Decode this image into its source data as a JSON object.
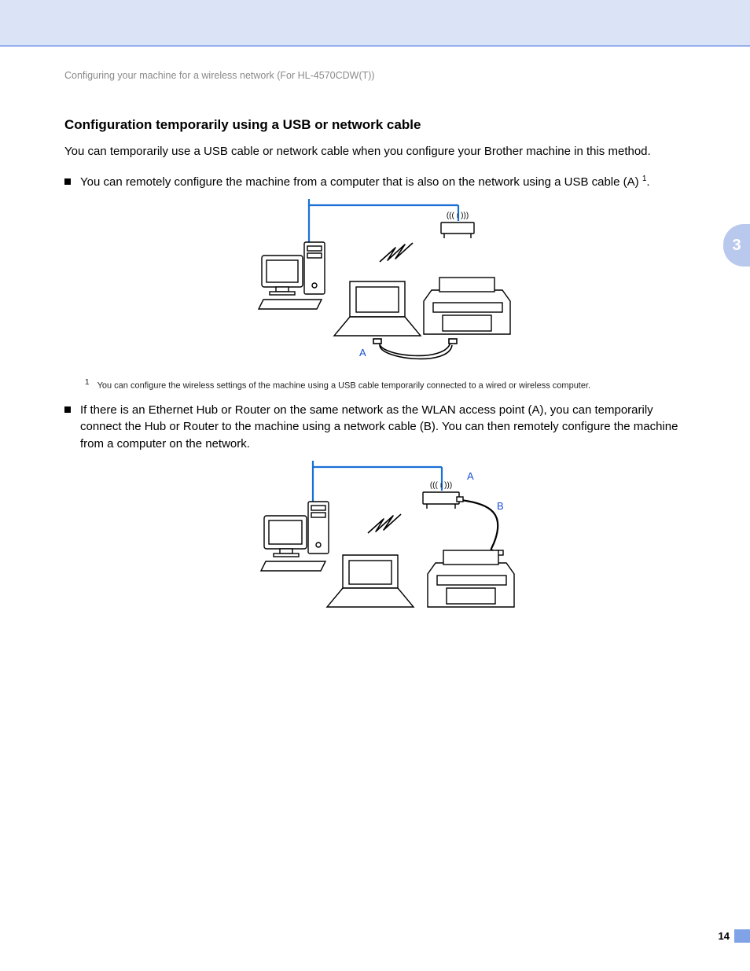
{
  "breadcrumb": "Configuring your machine for a wireless network (For HL-4570CDW(T))",
  "section_title": "Configuration temporarily using a USB or network cable",
  "intro": "You can temporarily use a USB cable or network cable when you configure your Brother machine in this method.",
  "bullet1_pre": "You can remotely configure the machine from a computer that is also on the network using a USB cable (A) ",
  "bullet1_sup": "1",
  "bullet1_post": ".",
  "diagram1": {
    "label_A": "A"
  },
  "footnote1_mark": "1",
  "footnote1_text": "You can configure the wireless settings of the machine using a USB cable temporarily connected to a wired or wireless computer.",
  "bullet2": "If there is an Ethernet Hub or Router on the same network as the WLAN access point (A), you can temporarily connect the Hub or Router to the machine using a network cable (B). You can then remotely configure the machine from a computer on the network.",
  "diagram2": {
    "label_A": "A",
    "label_B": "B"
  },
  "chapter_tab": "3",
  "page_number": "14"
}
